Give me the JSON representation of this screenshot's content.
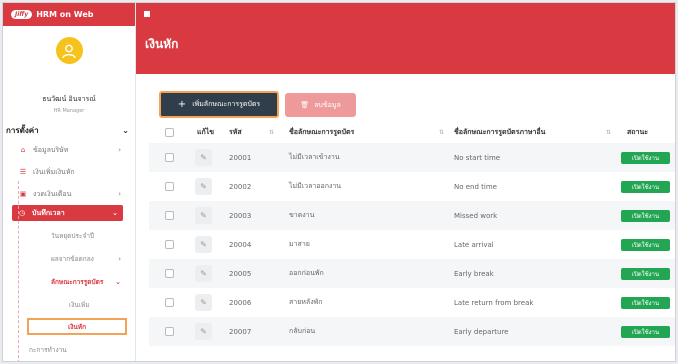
{
  "app": {
    "logo_text": "Jiffy",
    "title": "HRM on Web"
  },
  "user": {
    "name": "ธนวัฒน์ อินจารณ์",
    "role": "HR Manager"
  },
  "menu": {
    "section": "การตั้งค่า",
    "items": [
      {
        "label": "ข้อมูลบริษัท",
        "icon": "home-icon"
      },
      {
        "label": "เงินเพิ่มเงินหัก",
        "icon": "list-icon"
      },
      {
        "label": "งวดเงินเดือน",
        "icon": "calendar-icon"
      }
    ],
    "active": "บันทึกเวลา",
    "subitems": [
      "วันหยุดประจำปี",
      "ผลจากข้อตกลง",
      "ลักษณะการรูดบัตร"
    ],
    "subsub": [
      "เงินเพิ่ม",
      "เงินหัก"
    ],
    "last": "กะการทำงาน"
  },
  "page": {
    "title": "เงินหัก"
  },
  "toolbar": {
    "add_label": "เพิ่มลักษณะการรูดบัตร",
    "delete_label": "ลบข้อมูล"
  },
  "table": {
    "headers": {
      "edit": "แก้ไข",
      "code": "รหัส",
      "name_th": "ชื่อลักษณะการรูดบัตร",
      "name_en": "ชื่อลักษณะการรูดบัตรภาษาอื่น",
      "status": "สถานะ"
    },
    "rows": [
      {
        "code": "20001",
        "th": "ไม่มีเวลาเข้างาน",
        "en": "No start time",
        "status": "เปิดใช้งาน"
      },
      {
        "code": "20002",
        "th": "ไม่มีเวลาออกงาน",
        "en": "No end time",
        "status": "เปิดใช้งาน"
      },
      {
        "code": "20003",
        "th": "ขาดงาน",
        "en": "Missed work",
        "status": "เปิดใช้งาน"
      },
      {
        "code": "20004",
        "th": "มาสาย",
        "en": "Late arrival",
        "status": "เปิดใช้งาน"
      },
      {
        "code": "20005",
        "th": "ออกก่อนพัก",
        "en": "Early break",
        "status": "เปิดใช้งาน"
      },
      {
        "code": "20006",
        "th": "สายหลังพัก",
        "en": "Late return from break",
        "status": "เปิดใช้งาน"
      },
      {
        "code": "20007",
        "th": "กลับก่อน",
        "en": "Early departure",
        "status": "เปิดใช้งาน"
      }
    ]
  },
  "colors": {
    "brand": "#d93a42",
    "status_active": "#22a654",
    "highlight": "#f2a356"
  }
}
